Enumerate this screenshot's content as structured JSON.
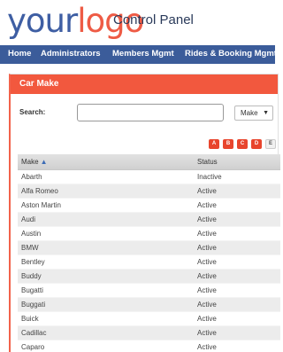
{
  "header": {
    "logo_part1": "your",
    "logo_part2": "logo",
    "title": "Control Panel"
  },
  "nav": {
    "items": [
      {
        "label": "Home"
      },
      {
        "label": "Administrators"
      },
      {
        "label": "Members Mgmt"
      },
      {
        "label": "Rides & Booking Mgmt"
      }
    ]
  },
  "panel": {
    "title": "Car Make",
    "search_label": "Search:",
    "search_value": "",
    "search_field": "Make",
    "letters": [
      "A",
      "B",
      "C",
      "D",
      "E"
    ]
  },
  "table": {
    "columns": [
      "Make",
      "Status"
    ],
    "rows": [
      {
        "make": "Abarth",
        "status": "Inactive"
      },
      {
        "make": "Alfa Romeo",
        "status": "Active"
      },
      {
        "make": "Aston Martin",
        "status": "Active"
      },
      {
        "make": "Audi",
        "status": "Active"
      },
      {
        "make": "Austin",
        "status": "Active"
      },
      {
        "make": "BMW",
        "status": "Active"
      },
      {
        "make": "Bentley",
        "status": "Active"
      },
      {
        "make": "Buddy",
        "status": "Active"
      },
      {
        "make": "Bugatti",
        "status": "Active"
      },
      {
        "make": "Buggati",
        "status": "Active"
      },
      {
        "make": "Buick",
        "status": "Active"
      },
      {
        "make": "Cadillac",
        "status": "Active"
      },
      {
        "make": "Caparo",
        "status": "Active"
      }
    ]
  },
  "colors": {
    "nav_bg": "#3b5c9a",
    "accent": "#f2583e",
    "logo_blue": "#3e5ea3",
    "logo_red": "#ee5b45"
  }
}
